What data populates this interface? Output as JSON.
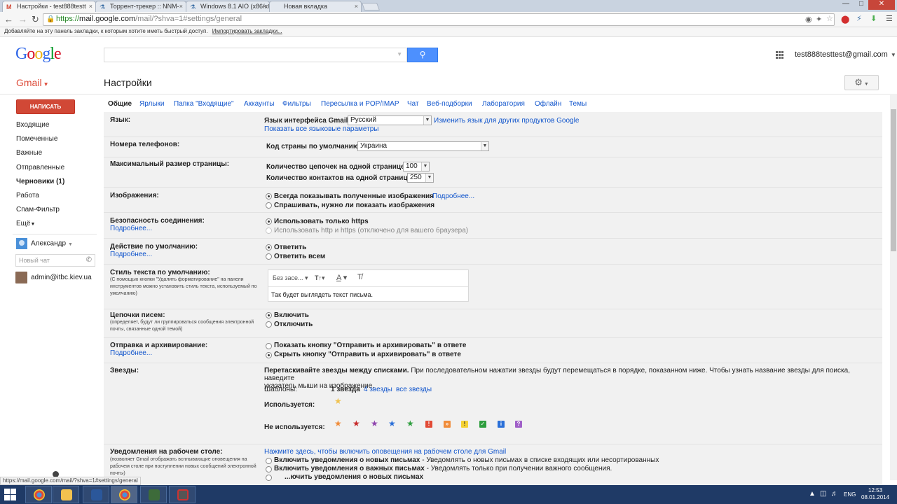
{
  "browser": {
    "tabs": [
      {
        "favicon": "M",
        "title": "Настройки - test888testt",
        "active": true
      },
      {
        "favicon": "⚗",
        "title": "Торрент-трекер :: NNM-",
        "active": false
      },
      {
        "favicon": "⚗",
        "title": "Windows 8.1 AIO (x86/x64",
        "active": false
      },
      {
        "favicon": "",
        "title": "Новая вкладка",
        "active": false
      }
    ],
    "tab_close": "×",
    "window_controls": [
      "—",
      "□",
      "✕"
    ],
    "url_scheme": "https://",
    "url_host": "mail.google.com",
    "url_path": "/mail/?shva=1#settings/general",
    "bookmarks_prompt": "Добавляйте на эту панель закладки, к которым хотите иметь быстрый доступ.",
    "import_bookmarks": "Импортировать закладки..."
  },
  "header": {
    "logo": [
      "G",
      "o",
      "o",
      "g",
      "l",
      "e"
    ],
    "logo_colors": [
      "#3369e8",
      "#d50f25",
      "#eeb211",
      "#3369e8",
      "#009925",
      "#d50f25"
    ],
    "search_value": "",
    "account": "test888testtest@gmail.com"
  },
  "toolbar": {
    "brand": "Gmail",
    "page_title": "Настройки"
  },
  "nav": {
    "compose": "НАПИСАТЬ",
    "items": [
      {
        "label": "Входящие",
        "bold": false
      },
      {
        "label": "Помеченные",
        "bold": false
      },
      {
        "label": "Важные",
        "bold": false
      },
      {
        "label": "Отправленные",
        "bold": false
      },
      {
        "label": "Черновики (1)",
        "bold": true
      },
      {
        "label": "Работа",
        "bold": false
      },
      {
        "label": "Спам-Фильтр",
        "bold": false
      },
      {
        "label": "Ещё",
        "bold": false
      }
    ],
    "chat_user": "Александр",
    "chat_placeholder": "Новый чат",
    "contact": "admin@itbc.kiev.ua"
  },
  "settings_tabs": [
    "Общие",
    "Ярлыки",
    "Папка \"Входящие\"",
    "Аккаунты",
    "Фильтры",
    "Пересылка и POP/IMAP",
    "Чат",
    "Веб-подборки",
    "Лаборатория",
    "Офлайн",
    "Темы"
  ],
  "settings": {
    "language": {
      "label": "Язык:",
      "field": "Язык интерфейса Gmail:",
      "value": "Русский",
      "change_link": "Изменить язык для других продуктов Google",
      "show_all": "Показать все языковые параметры"
    },
    "phones": {
      "label": "Номера телефонов:",
      "field": "Код страны по умолчанию:",
      "value": "Украина"
    },
    "page_size": {
      "label": "Максимальный размер страницы:",
      "threads_label": "Количество цепочек на одной странице:",
      "threads_value": "100",
      "contacts_label": "Количество контактов на одной странице:",
      "contacts_value": "250"
    },
    "images": {
      "label": "Изображения:",
      "opt1": "Всегда показывать полученные изображения",
      "opt1_link": "Подробнее...",
      "opt2": "Спрашивать, нужно ли показать изображения"
    },
    "security": {
      "label": "Безопасность соединения:",
      "more": "Подробнее...",
      "opt1": "Использовать только https",
      "opt2": "Использовать http и https (отключено для вашего браузера)"
    },
    "default_action": {
      "label": "Действие по умолчанию:",
      "more": "Подробнее...",
      "opt1": "Ответить",
      "opt2": "Ответить всем"
    },
    "text_style": {
      "label": "Стиль текста по умолчанию:",
      "note": "(С помощью кнопки \"Удалить форматирование\" на панели инструментов можно установить стиль текста, используемый по умолчанию)",
      "font": "Без засе...",
      "sample": "Так будет выглядеть текст письма."
    },
    "threads": {
      "label": "Цепочки писем:",
      "note": "(определяет, будут ли группироваться сообщения электронной почты, связанные одной темой)",
      "opt1": "Включить",
      "opt2": "Отключить"
    },
    "send_archive": {
      "label": "Отправка и архивирование:",
      "more": "Подробнее...",
      "opt1": "Показать кнопку \"Отправить и архивировать\" в ответе",
      "opt2": "Скрыть кнопку \"Отправить и архивировать\" в ответе"
    },
    "stars": {
      "label": "Звезды:",
      "intro_bold": "Перетаскивайте звезды между списками.",
      "intro_rest": "При последовательном нажатии звезды будут перемещаться в порядке, показанном ниже. Чтобы узнать название звезды для поиска, наведите",
      "intro_line2": "указатель мыши на изображение.",
      "presets_label": "Шаблоны:",
      "preset1": "1 звезда",
      "preset4": "4 звезды",
      "preset_all": "все звезды",
      "in_use": "Используется:",
      "not_in_use": "Не используется:"
    },
    "notifications": {
      "label": "Уведомления на рабочем столе:",
      "note": "(позволяет Gmail отображать всплывающие оповещения на рабочем столе при поступлении новых сообщений электронной почты)",
      "enable_link": "Нажмите здесь, чтобы включить оповещения на рабочем столе для Gmail",
      "opt1_bold": "Включить уведомления о новых письмах",
      "opt1_rest": "- Уведомлять о новых письмах в списке входящих или несортированных",
      "opt2_bold": "Включить уведомления о важных письмах",
      "opt2_rest": "- Уведомлять только при получении важного сообщения.",
      "opt3_bold": "...ючить уведомления о новых письмах"
    }
  },
  "status_url": "https://mail.google.com/mail/?shva=1#settings/general",
  "taskbar": {
    "lang": "ENG",
    "time": "12:53",
    "date": "08.01.2014"
  }
}
